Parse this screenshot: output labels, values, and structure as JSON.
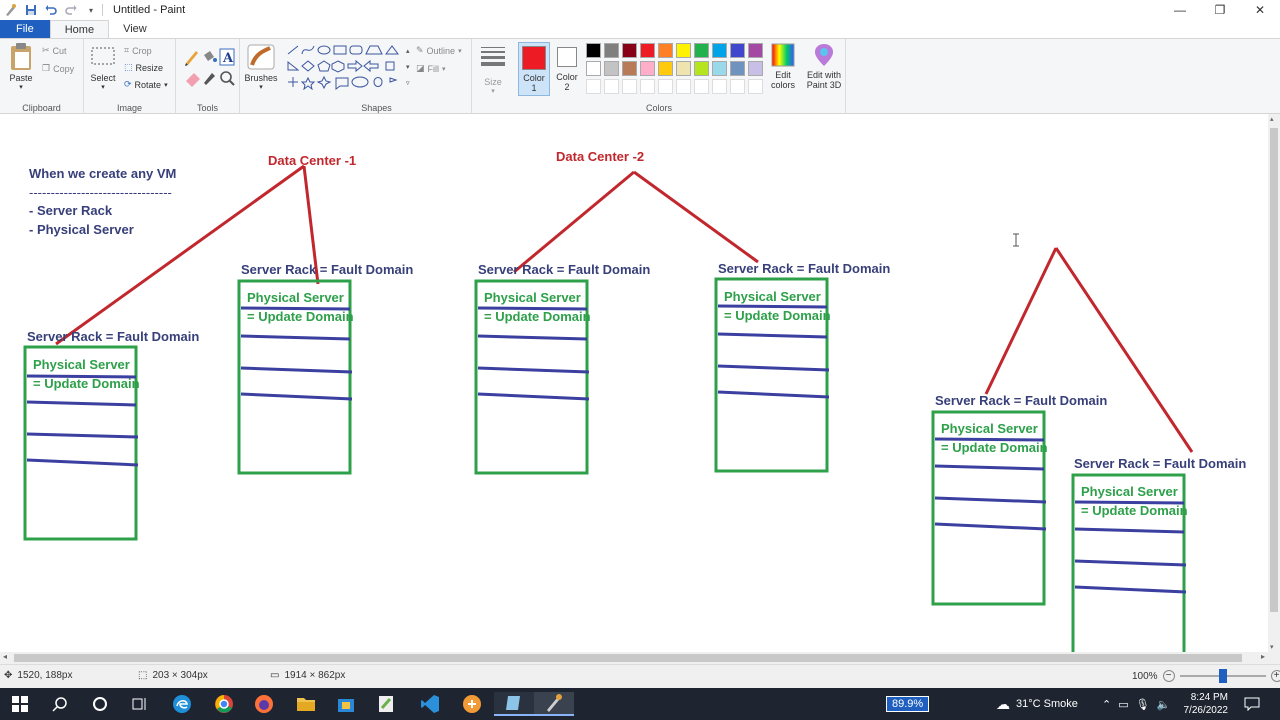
{
  "window": {
    "title": "Untitled - Paint",
    "controls": {
      "minimize": "—",
      "maximize": "❐",
      "close": "✕"
    }
  },
  "tabs": [
    {
      "label": "File"
    },
    {
      "label": "Home"
    },
    {
      "label": "View"
    }
  ],
  "ribbon": {
    "clipboard": {
      "group": "Clipboard",
      "paste": "Paste",
      "cut": "Cut",
      "copy": "Copy"
    },
    "image": {
      "group": "Image",
      "select": "Select",
      "crop": "Crop",
      "resize": "Resize",
      "rotate": "Rotate"
    },
    "tools": {
      "group": "Tools"
    },
    "brushes": {
      "label": "Brushes"
    },
    "shapes": {
      "group": "Shapes",
      "outline": "Outline",
      "fill": "Fill"
    },
    "size": {
      "label": "Size"
    },
    "colors": {
      "group": "Colors",
      "color1": "Color\n1",
      "color1_a": "Color",
      "color1_b": "1",
      "color2_a": "Color",
      "color2_b": "2",
      "edit_a": "Edit",
      "edit_b": "colors",
      "paint3d_a": "Edit with",
      "paint3d_b": "Paint 3D",
      "color1_value": "#ed1c24",
      "color2_value": "#ffffff",
      "palette_row1": [
        "#000000",
        "#7f7f7f",
        "#880015",
        "#ed1c24",
        "#ff7f27",
        "#fff200",
        "#22b14c",
        "#00a2e8",
        "#3f48cc",
        "#a349a4"
      ],
      "palette_row2": [
        "#ffffff",
        "#c3c3c3",
        "#b97a57",
        "#ffaec9",
        "#ffc90e",
        "#efe4b0",
        "#b5e61d",
        "#99d9ea",
        "#7092be",
        "#c8bfe7"
      ]
    }
  },
  "drawing": {
    "colors": {
      "red": "#c1272d",
      "green": "#2ea04a",
      "blue": "#3b3fa0",
      "navy": "#38407a"
    },
    "notes": {
      "heading": "When we create any VM",
      "divider": "---------------------------------",
      "item1": "- Server Rack",
      "item2": "- Physical Server"
    },
    "datacenter1": "Data Center -1",
    "datacenter2": "Data Center -2",
    "rack_label": "Server Rack = Fault Domain",
    "server_label": "Physical Server",
    "update_label": "= Update Domain"
  },
  "status": {
    "cursor": "1520, 188px",
    "selection": "203 × 304px",
    "image_size": "1914 × 862px",
    "zoom": "100%",
    "zoom_fraction": 0.5
  },
  "taskbar": {
    "battery_label": "89.9%",
    "weather": "31°C  Smoke",
    "time": "8:24 PM",
    "date": "7/26/2022"
  }
}
